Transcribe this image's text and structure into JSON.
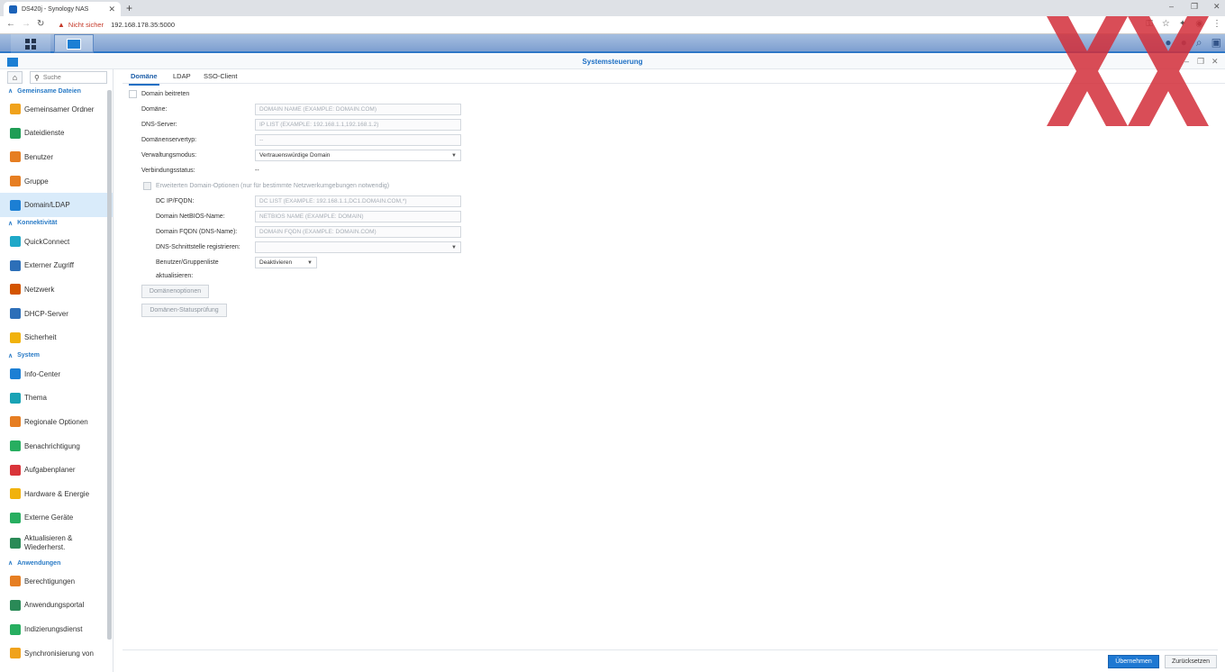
{
  "browser": {
    "tab_title": "DS420j - Synology NAS",
    "not_secure": "Nicht sicher",
    "url": "192.168.178.35:5000"
  },
  "window": {
    "title": "Systemsteuerung"
  },
  "sidebar": {
    "search_placeholder": "Suche",
    "sections": [
      {
        "label": "Gemeinsame Dateien",
        "items": [
          {
            "label": "Gemeinsamer Ordner",
            "icon": "shared-folder-icon",
            "color": "#f0a21c"
          },
          {
            "label": "Dateidienste",
            "icon": "file-services-icon",
            "color": "#1f9d55"
          },
          {
            "label": "Benutzer",
            "icon": "user-icon",
            "color": "#e67e22"
          },
          {
            "label": "Gruppe",
            "icon": "group-icon",
            "color": "#e67e22"
          },
          {
            "label": "Domain/LDAP",
            "icon": "domain-icon",
            "color": "#1c7fd4",
            "selected": true
          }
        ]
      },
      {
        "label": "Konnektivität",
        "items": [
          {
            "label": "QuickConnect",
            "icon": "quickconnect-icon",
            "color": "#1fa8c8"
          },
          {
            "label": "Externer Zugriff",
            "icon": "external-access-icon",
            "color": "#2d6fb8"
          },
          {
            "label": "Netzwerk",
            "icon": "network-icon",
            "color": "#d35400"
          },
          {
            "label": "DHCP-Server",
            "icon": "dhcp-icon",
            "color": "#2d6fb8"
          },
          {
            "label": "Sicherheit",
            "icon": "security-icon",
            "color": "#f1b20c"
          }
        ]
      },
      {
        "label": "System",
        "items": [
          {
            "label": "Info-Center",
            "icon": "info-icon",
            "color": "#1c7fd4"
          },
          {
            "label": "Thema",
            "icon": "theme-icon",
            "color": "#19a3b5"
          },
          {
            "label": "Regionale Optionen",
            "icon": "regional-icon",
            "color": "#e67e22"
          },
          {
            "label": "Benachrichtigung",
            "icon": "notification-icon",
            "color": "#27ae60"
          },
          {
            "label": "Aufgabenplaner",
            "icon": "task-scheduler-icon",
            "color": "#d9343a"
          },
          {
            "label": "Hardware & Energie",
            "icon": "hardware-icon",
            "color": "#f1b20c"
          },
          {
            "label": "Externe Geräte",
            "icon": "external-devices-icon",
            "color": "#27ae60"
          },
          {
            "label": "Aktualisieren & Wiederherst.",
            "icon": "update-icon",
            "color": "#2a8a57"
          }
        ]
      },
      {
        "label": "Anwendungen",
        "items": [
          {
            "label": "Berechtigungen",
            "icon": "privileges-icon",
            "color": "#e67e22"
          },
          {
            "label": "Anwendungsportal",
            "icon": "app-portal-icon",
            "color": "#2a8a57"
          },
          {
            "label": "Indizierungsdienst",
            "icon": "indexing-icon",
            "color": "#27ae60"
          },
          {
            "label": "Synchronisierung von",
            "icon": "sync-icon",
            "color": "#f0a21c"
          }
        ]
      }
    ]
  },
  "tabs": [
    "Domäne",
    "LDAP",
    "SSO-Client"
  ],
  "form": {
    "join_domain": "Domain beitreten",
    "domain_label": "Domäne:",
    "domain_placeholder": "DOMAIN NAME (EXAMPLE: DOMAIN.COM)",
    "dns_label": "DNS-Server:",
    "dns_placeholder": "IP LIST (EXAMPLE: 192.168.1.1,192.168.1.2)",
    "server_type_label": "Domänenservertyp:",
    "server_type_value": "--",
    "mgmt_mode_label": "Verwaltungsmodus:",
    "mgmt_mode_value": "Vertrauenswürdige Domain",
    "conn_status_label": "Verbindungsstatus:",
    "conn_status_value": "--",
    "advanced_label": "Erweiterten Domain-Optionen (nur für bestimmte Netzwerkumgebungen notwendig)",
    "dc_label": "DC IP/FQDN:",
    "dc_placeholder": "DC LIST (EXAMPLE: 192.168.1.1,DC1.DOMAIN.COM,*)",
    "netbios_label": "Domain NetBIOS-Name:",
    "netbios_placeholder": "NETBIOS NAME (EXAMPLE: DOMAIN)",
    "fqdn_label": "Domain FQDN (DNS-Name):",
    "fqdn_placeholder": "DOMAIN FQDN (EXAMPLE: DOMAIN.COM)",
    "dns_iface_label": "DNS-Schnittstelle registrieren:",
    "userlist_label_1": "Benutzer/Gruppenliste",
    "userlist_label_2": "aktualisieren:",
    "userlist_value": "Deaktivieren",
    "domain_options_btn": "Domänenoptionen",
    "domain_status_btn": "Domänen-Statusprüfung"
  },
  "footer": {
    "apply": "Übernehmen",
    "reset": "Zurücksetzen"
  },
  "colors": {
    "accent": "#1d6fc4",
    "overlay_red": "#d32f3a"
  }
}
